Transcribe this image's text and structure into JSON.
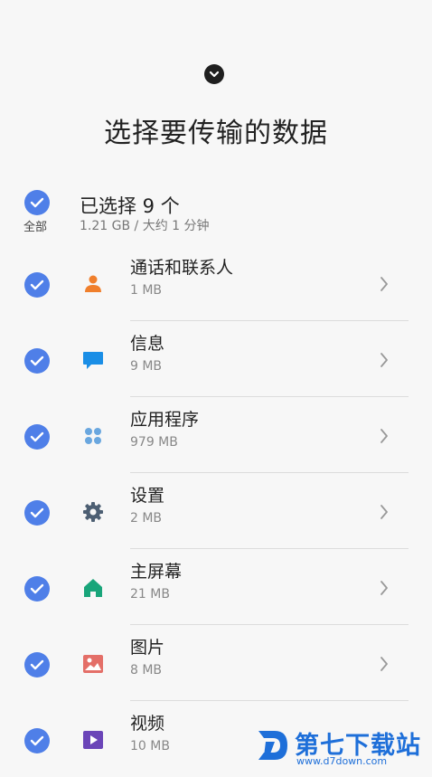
{
  "header": {
    "title": "选择要传输的数据",
    "icon": "chevron-down-circle-icon"
  },
  "select_all": {
    "label": "全部",
    "title": "已选择 9 个",
    "subtitle": "1.21 GB / 大约 1 分钟"
  },
  "categories": [
    {
      "name": "通话和联系人",
      "size": "1 MB",
      "icon": "person-icon",
      "color": "#f07f2c"
    },
    {
      "name": "信息",
      "size": "9 MB",
      "icon": "message-icon",
      "color": "#1a8ee6"
    },
    {
      "name": "应用程序",
      "size": "979 MB",
      "icon": "apps-icon",
      "color": "#6aa7df"
    },
    {
      "name": "设置",
      "size": "2 MB",
      "icon": "gear-icon",
      "color": "#4d5f73"
    },
    {
      "name": "主屏幕",
      "size": "21 MB",
      "icon": "home-icon",
      "color": "#19a57a"
    },
    {
      "name": "图片",
      "size": "8 MB",
      "icon": "image-icon",
      "color": "#e46f68"
    },
    {
      "name": "视频",
      "size": "10 MB",
      "icon": "video-icon",
      "color": "#6b45b8"
    }
  ],
  "watermark": {
    "text": "第七下载站",
    "url": "www.d7down.com"
  },
  "colors": {
    "accent": "#4f7fe8",
    "background": "#f7f7f7"
  }
}
